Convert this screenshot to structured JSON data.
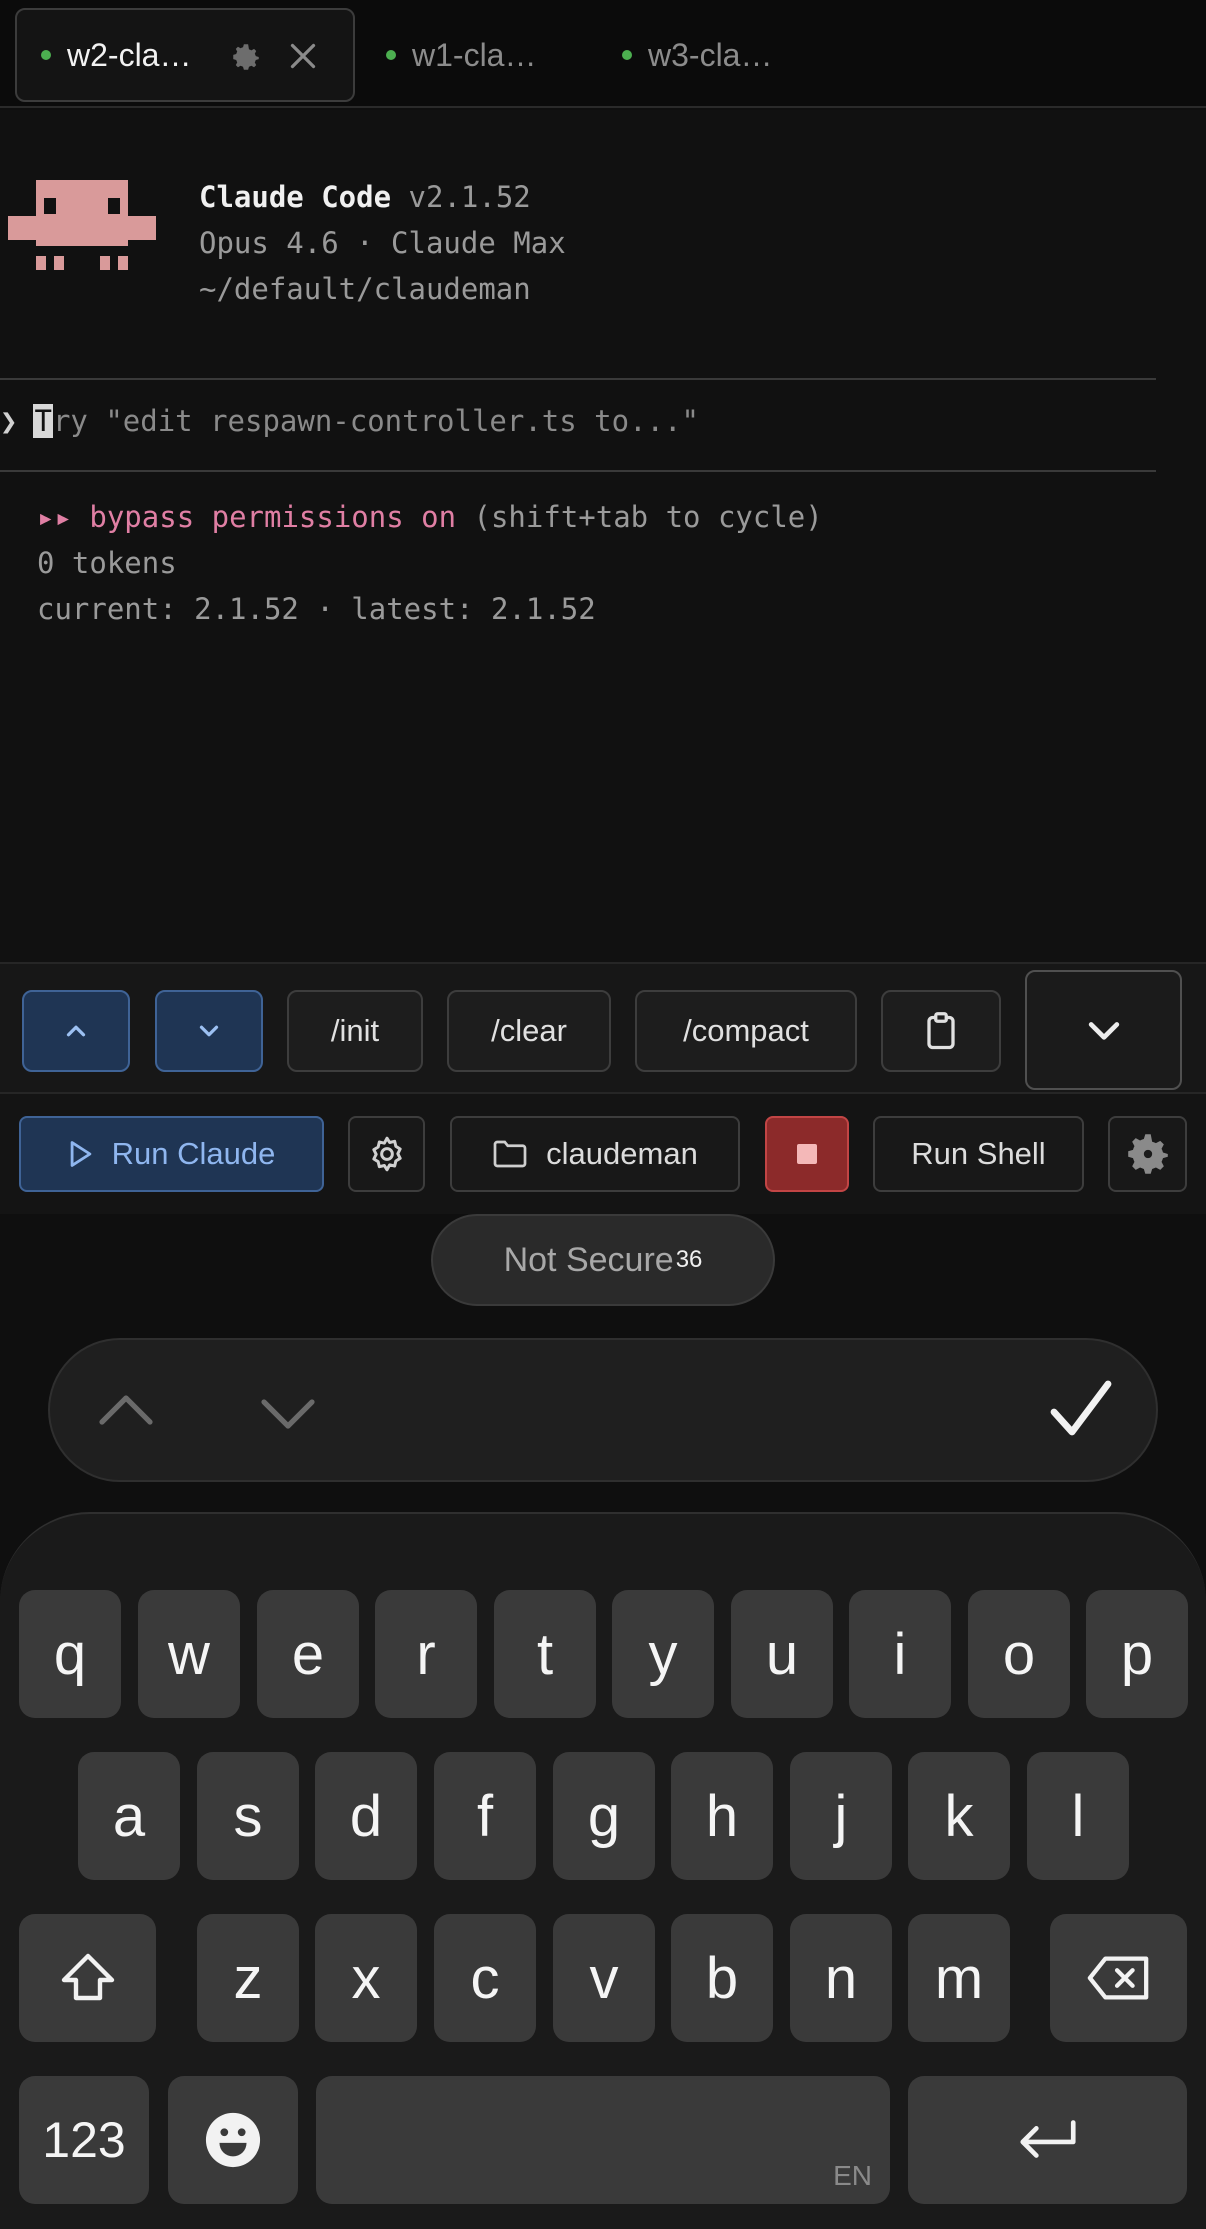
{
  "tabs": [
    {
      "label": "w2-cla…",
      "active": true
    },
    {
      "label": "w1-cla…",
      "active": false
    },
    {
      "label": "w3-cla…",
      "active": false
    }
  ],
  "terminal": {
    "app_name": "Claude Code",
    "version": "v2.1.52",
    "model_line": "Opus 4.6 · Claude Max",
    "path": "~/default/claudeman",
    "prompt_cursor_char": "T",
    "prompt_placeholder": "ry \"edit respawn-controller.ts to...\"",
    "mode_arrows": "▸▸",
    "mode_label": "bypass permissions on",
    "mode_hint": "(shift+tab to cycle)",
    "tokens": "0 tokens",
    "versions": "current: 2.1.52 · latest: 2.1.52"
  },
  "shortcuts": {
    "init": "/init",
    "clear": "/clear",
    "compact": "/compact"
  },
  "actions": {
    "run_claude": "Run Claude",
    "folder": "claudeman",
    "run_shell": "Run Shell"
  },
  "browser": {
    "security": "Not Secure",
    "time_fragment": "36"
  },
  "keyboard": {
    "row1": [
      "q",
      "w",
      "e",
      "r",
      "t",
      "y",
      "u",
      "i",
      "o",
      "p"
    ],
    "row2": [
      "a",
      "s",
      "d",
      "f",
      "g",
      "h",
      "j",
      "k",
      "l"
    ],
    "row3": [
      "z",
      "x",
      "c",
      "v",
      "b",
      "n",
      "m"
    ],
    "numbers": "123",
    "language": "EN"
  },
  "colors": {
    "accent_blue": "#1f3554",
    "stop_red": "#8c2a2a",
    "mode_pink": "#e07fa4",
    "status_dot": "#4caf50"
  }
}
